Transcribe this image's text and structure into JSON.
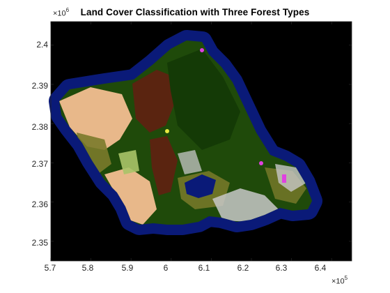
{
  "title": "Land Cover Classification with Three Forest Types",
  "x_axis": {
    "ticks": [
      "5.7",
      "5.8",
      "5.9",
      "6",
      "6.1",
      "6.2",
      "6.3",
      "6.4"
    ],
    "tick_values": [
      5.7,
      5.8,
      5.9,
      6.0,
      6.1,
      6.2,
      6.3,
      6.4
    ],
    "range": [
      5.7,
      6.45
    ],
    "exponent_base": "×10",
    "exponent": "5"
  },
  "y_axis": {
    "ticks": [
      "2.4",
      "2.39",
      "2.38",
      "2.37",
      "2.36",
      "2.35"
    ],
    "tick_values": [
      2.4,
      2.39,
      2.38,
      2.37,
      2.36,
      2.35
    ],
    "range": [
      2.345,
      2.406
    ],
    "exponent_base": "×10",
    "exponent": "6"
  },
  "colors": {
    "background": "#000000",
    "water_buffer": "#0a1a78",
    "forest": "#1f4a0a",
    "forest_dark": "#143a06",
    "brown": "#5a2410",
    "tan": "#e8b88a",
    "olive": "#7a7a2a",
    "lightgreen": "#a8c468",
    "urban": "#c8c8c8",
    "yellow": "#e8e840",
    "magenta": "#e040e0"
  }
}
